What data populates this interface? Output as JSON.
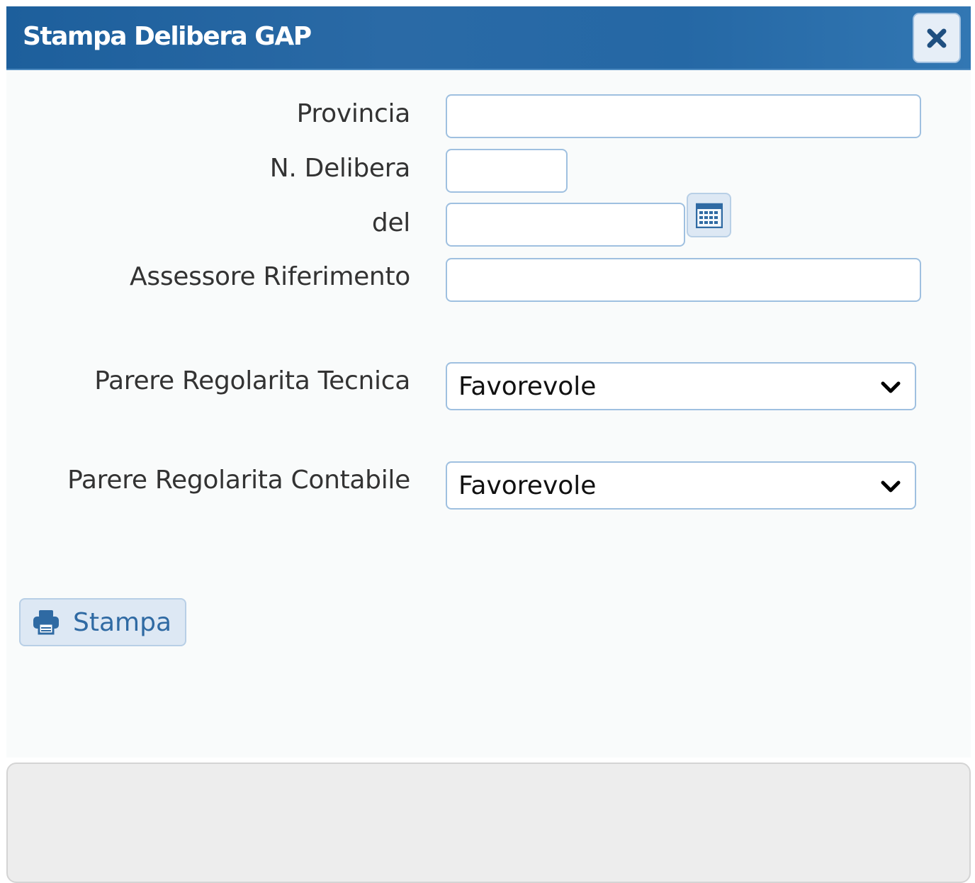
{
  "dialog": {
    "title": "Stampa Delibera GAP",
    "close_icon": "close-icon"
  },
  "form": {
    "provincia": {
      "label": "Provincia",
      "value": ""
    },
    "n_delibera": {
      "label": "N. Delibera",
      "value": ""
    },
    "del": {
      "label": "del",
      "value": "",
      "calendar_icon": "calendar-icon"
    },
    "assessore": {
      "label": "Assessore Riferimento",
      "value": ""
    },
    "parere_tecnica": {
      "label": "Parere Regolarita Tecnica",
      "selected": "Favorevole"
    },
    "parere_contabile": {
      "label": "Parere Regolarita Contabile",
      "selected": "Favorevole"
    }
  },
  "actions": {
    "print_label": "Stampa",
    "print_icon": "printer-icon"
  },
  "colors": {
    "titlebar": "#2568a5",
    "accent": "#2f6aa3",
    "field_border": "#9fc0e0"
  }
}
